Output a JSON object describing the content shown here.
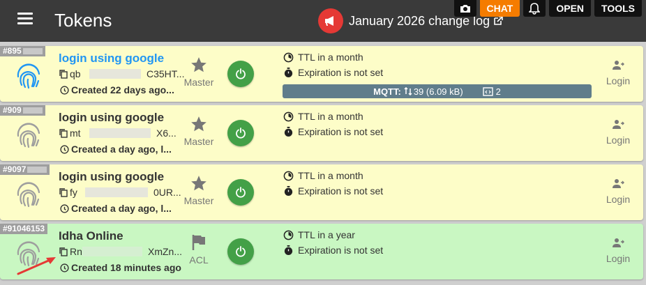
{
  "header": {
    "title": "Tokens",
    "changelog": "January 2026 change log",
    "toolbar": {
      "camera_icon": "camera-icon",
      "chat": "CHAT",
      "bell_icon": "bell-icon",
      "open": "OPEN",
      "tools": "TOOLS"
    }
  },
  "colors": {
    "header_bg": "#3a3a3a",
    "card_yellow": "#fdfdc8",
    "card_green": "#c9f7c2",
    "power_green": "#43a047",
    "link_blue": "#2196f3",
    "chat_orange": "#f57c00",
    "badge_red": "#e53935",
    "mqtt_bar": "#607d8b"
  },
  "tokens": [
    {
      "id": "#895",
      "name": "login using google",
      "token_prefix": "qb",
      "token_suffix": "C35HT...",
      "created": "Created 22 days ago...",
      "role": "Master",
      "ttl": "TTL in a month",
      "expiration": "Expiration is not set",
      "mqtt_label": "MQTT:",
      "mqtt_stats": "39 (6.09 kB)",
      "mqtt_count": "2",
      "action": "Login"
    },
    {
      "id": "#909",
      "name": "login using google",
      "token_prefix": "mt",
      "token_suffix": "X6...",
      "created": "Created a day ago, l...",
      "role": "Master",
      "ttl": "TTL in a month",
      "expiration": "Expiration is not set",
      "action": "Login"
    },
    {
      "id": "#9097",
      "name": "login using google",
      "token_prefix": "fy",
      "token_suffix": "0UR...",
      "created": "Created a day ago, l...",
      "role": "Master",
      "ttl": "TTL in a month",
      "expiration": "Expiration is not set",
      "action": "Login"
    },
    {
      "id": "#91046153",
      "name": "Idha Online",
      "token_prefix": "Rn",
      "token_suffix": "XmZn...",
      "created": "Created 18 minutes ago",
      "role": "ACL",
      "ttl": "TTL in a year",
      "expiration": "Expiration is not set",
      "action": "Login"
    }
  ]
}
